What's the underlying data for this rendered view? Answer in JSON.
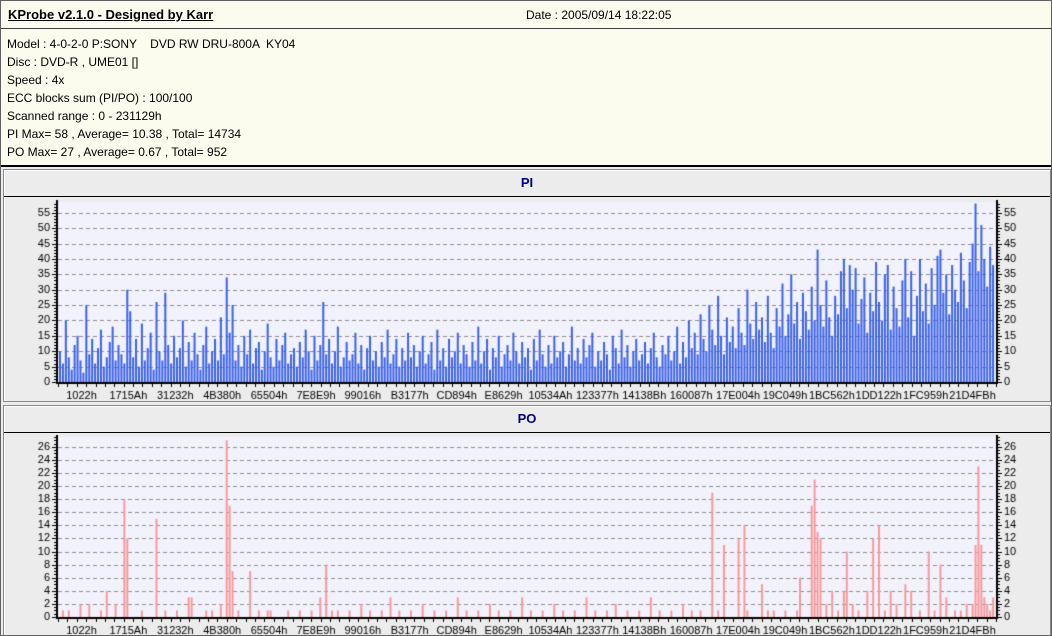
{
  "header": {
    "title": "KProbe v2.1.0 - Designed by Karr",
    "date": "Date : 2005/09/14 18:22:05"
  },
  "info": {
    "lines": [
      "Model : 4-0-2-0 P:SONY    DVD RW DRU-800A  KY04",
      "Disc : DVD-R , UME01 []",
      "Speed : 4x",
      "ECC blocks sum (PI/PO) : 100/100",
      "Scanned range : 0 - 231129h",
      "PI Max= 58 , Average= 10.38 , Total= 14734",
      "PO Max= 27 , Average= 0.67 , Total= 952"
    ]
  },
  "colors": {
    "window_bg": "#FBFBEE",
    "chart_area_bg": "#ECECEC",
    "plot_bg": "#F2F2FC",
    "grid": "#909090",
    "axis": "#000000",
    "tick_text": "#000000",
    "title_text": "#000080",
    "pi_bar": "#3B62EC",
    "po_bar": "#FA9A9A"
  },
  "chart_data": [
    {
      "type": "bar",
      "title": "PI",
      "color": "#3B62EC",
      "ylim": [
        0,
        58.5
      ],
      "y_ticks": [
        0,
        5,
        10,
        15,
        20,
        25,
        30,
        35,
        40,
        45,
        50,
        55
      ],
      "y_minor_step": 1,
      "grid": "dashed-horizontal",
      "x_tick_labels": [
        "1022h",
        "1715Ah",
        "31232h",
        "4B380h",
        "65504h",
        "7E8E9h",
        "99016h",
        "B3177h",
        "CD894h",
        "E8629h",
        "10534Ah",
        "123377h",
        "14138Bh",
        "160087h",
        "17E004h",
        "19C049h",
        "1BC562h",
        "1DD122h",
        "1FC959h",
        "21D4FBh"
      ],
      "stats": {
        "max": 58,
        "average": 10.38,
        "total": 14734
      },
      "values": [
        10,
        6,
        20,
        8,
        4,
        12,
        15,
        7,
        3,
        25,
        9,
        14,
        6,
        11,
        17,
        5,
        8,
        13,
        18,
        7,
        12,
        9,
        6,
        30,
        23,
        8,
        14,
        5,
        19,
        7,
        11,
        16,
        4,
        26,
        10,
        7,
        29,
        12,
        6,
        15,
        8,
        11,
        20,
        5,
        13,
        7,
        16,
        9,
        4,
        12,
        18,
        6,
        10,
        14,
        7,
        21,
        9,
        34,
        16,
        25,
        7,
        12,
        5,
        15,
        9,
        17,
        6,
        11,
        13,
        4,
        10,
        19,
        8,
        5,
        14,
        7,
        12,
        16,
        6,
        9,
        11,
        5,
        13,
        8,
        17,
        10,
        4,
        15,
        7,
        12,
        26,
        9,
        14,
        6,
        10,
        18,
        5,
        8,
        13,
        7,
        9,
        16,
        6,
        12,
        4,
        11,
        15,
        7,
        10,
        5,
        13,
        8,
        17,
        6,
        9,
        14,
        5,
        11,
        7,
        16,
        8,
        12,
        5,
        10,
        15,
        6,
        9,
        13,
        4,
        17,
        7,
        11,
        5,
        14,
        8,
        10,
        16,
        6,
        12,
        9,
        5,
        13,
        7,
        18,
        6,
        10,
        14,
        4,
        11,
        8,
        15,
        5,
        9,
        12,
        7,
        16,
        10,
        6,
        13,
        8,
        11,
        4,
        14,
        7,
        17,
        9,
        5,
        12,
        6,
        15,
        8,
        10,
        13,
        5,
        9,
        18,
        7,
        11,
        6,
        14,
        8,
        12,
        16,
        5,
        10,
        7,
        13,
        9,
        4,
        15,
        11,
        6,
        17,
        8,
        12,
        5,
        10,
        14,
        7,
        9,
        13,
        6,
        11,
        16,
        8,
        5,
        12,
        9,
        15,
        7,
        10,
        18,
        6,
        13,
        8,
        20,
        11,
        16,
        9,
        22,
        14,
        10,
        25,
        17,
        12,
        28,
        15,
        9,
        21,
        13,
        18,
        11,
        24,
        16,
        12,
        30,
        19,
        14,
        26,
        17,
        21,
        13,
        28,
        16,
        11,
        24,
        18,
        32,
        15,
        22,
        35,
        19,
        26,
        14,
        29,
        23,
        17,
        31,
        20,
        43,
        25,
        18,
        33,
        21,
        15,
        28,
        22,
        36,
        40,
        24,
        38,
        30,
        37,
        19,
        27,
        34,
        16,
        29,
        23,
        39,
        26,
        20,
        35,
        38,
        17,
        31,
        24,
        18,
        33,
        40,
        21,
        36,
        15,
        28,
        40,
        23,
        32,
        19,
        37,
        25,
        41,
        43,
        29,
        35,
        22,
        38,
        30,
        26,
        42,
        33,
        24,
        39,
        45,
        58,
        36,
        51,
        40,
        31,
        44,
        38
      ]
    },
    {
      "type": "bar",
      "title": "PO",
      "color": "#FA9A9A",
      "ylim": [
        0,
        27.5
      ],
      "y_ticks": [
        0,
        2,
        4,
        6,
        8,
        10,
        12,
        14,
        16,
        18,
        20,
        22,
        24,
        26
      ],
      "y_minor_step": 0.5,
      "grid": "dashed-horizontal",
      "x_tick_labels": [
        "1022h",
        "1715Ah",
        "31232h",
        "4B380h",
        "65504h",
        "7E8E9h",
        "99016h",
        "B3177h",
        "CD894h",
        "E8629h",
        "10534Ah",
        "123377h",
        "14138Bh",
        "160087h",
        "17E004h",
        "19C049h",
        "1BC562h",
        "1DD122h",
        "1FC959h",
        "21D4FBh"
      ],
      "stats": {
        "max": 27,
        "average": 0.67,
        "total": 952
      },
      "values": [
        0,
        1,
        0,
        1,
        0,
        0,
        0,
        2,
        0,
        0,
        2,
        0,
        0,
        0,
        1,
        0,
        4,
        0,
        0,
        2,
        0,
        0,
        18,
        12,
        0,
        0,
        0,
        0,
        1,
        0,
        0,
        0,
        0,
        15,
        0,
        0,
        1,
        0,
        0,
        0,
        1,
        0,
        0,
        0,
        3,
        3,
        0,
        0,
        0,
        0,
        1,
        0,
        1,
        0,
        0,
        2,
        0,
        27,
        17,
        7,
        0,
        1,
        0,
        0,
        0,
        7,
        0,
        0,
        1,
        0,
        0,
        1,
        1,
        0,
        0,
        0,
        0,
        0,
        1,
        0,
        0,
        0,
        1,
        0,
        0,
        0,
        1,
        0,
        0,
        3,
        0,
        8,
        0,
        1,
        0,
        1,
        0,
        0,
        0,
        1,
        0,
        0,
        0,
        2,
        0,
        0,
        1,
        0,
        0,
        0,
        1,
        0,
        0,
        3,
        0,
        0,
        1,
        0,
        0,
        0,
        1,
        0,
        0,
        0,
        2,
        0,
        0,
        0,
        1,
        0,
        0,
        0,
        1,
        0,
        0,
        0,
        3,
        0,
        0,
        1,
        0,
        0,
        0,
        1,
        0,
        0,
        0,
        2,
        0,
        0,
        1,
        0,
        0,
        0,
        1,
        0,
        0,
        0,
        3,
        0,
        0,
        1,
        0,
        0,
        0,
        1,
        0,
        0,
        0,
        2,
        0,
        0,
        1,
        0,
        0,
        0,
        1,
        0,
        0,
        0,
        3,
        0,
        0,
        1,
        0,
        0,
        0,
        1,
        0,
        0,
        2,
        0,
        0,
        0,
        1,
        0,
        0,
        0,
        1,
        0,
        0,
        0,
        3,
        0,
        0,
        1,
        0,
        0,
        0,
        1,
        0,
        0,
        0,
        2,
        0,
        0,
        1,
        0,
        0,
        1,
        0,
        0,
        0,
        19,
        0,
        1,
        0,
        11,
        0,
        0,
        0,
        0,
        12,
        0,
        14,
        1,
        0,
        0,
        0,
        0,
        5,
        0,
        1,
        0,
        1,
        0,
        0,
        0,
        1,
        0,
        0,
        0,
        1,
        6,
        0,
        0,
        0,
        17,
        21,
        13,
        12,
        0,
        2,
        0,
        4,
        0,
        1,
        0,
        4,
        10,
        0,
        2,
        0,
        1,
        0,
        0,
        4,
        0,
        12,
        0,
        14,
        0,
        1,
        0,
        4,
        0,
        2,
        0,
        0,
        5,
        0,
        4,
        0,
        0,
        1,
        0,
        0,
        10,
        0,
        1,
        0,
        8,
        0,
        3,
        0,
        0,
        1,
        0,
        1,
        0,
        2,
        0,
        2,
        11,
        23,
        11,
        3,
        2,
        1,
        3
      ]
    }
  ]
}
